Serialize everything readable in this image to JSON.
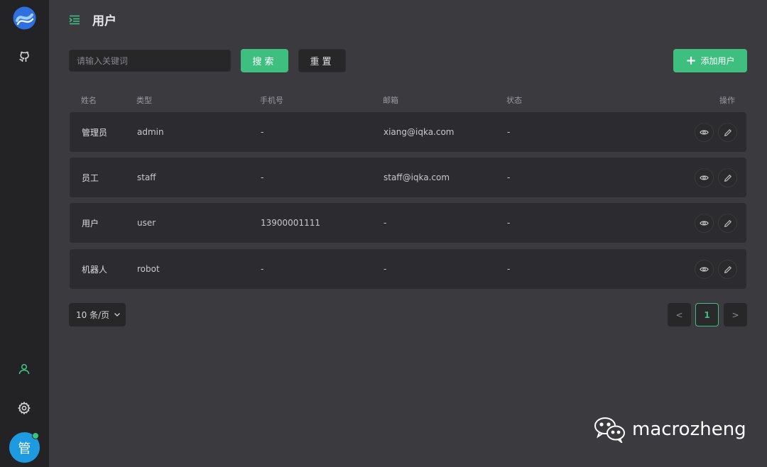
{
  "header": {
    "title": "用户"
  },
  "toolbar": {
    "search_placeholder": "请输入关键词",
    "search_label": "搜索",
    "reset_label": "重置",
    "add_label": "添加用户"
  },
  "table": {
    "columns": [
      "姓名",
      "类型",
      "手机号",
      "邮箱",
      "状态",
      "操作"
    ],
    "rows": [
      {
        "name": "管理员",
        "type": "admin",
        "phone": "-",
        "email": "xiang@iqka.com",
        "status": "-"
      },
      {
        "name": "员工",
        "type": "staff",
        "phone": "-",
        "email": "staff@iqka.com",
        "status": "-"
      },
      {
        "name": "用户",
        "type": "user",
        "phone": "13900001111",
        "email": "-",
        "status": "-"
      },
      {
        "name": "机器人",
        "type": "robot",
        "phone": "-",
        "email": "-",
        "status": "-"
      }
    ]
  },
  "pagination": {
    "page_size": "10 条/页",
    "current_page": "1",
    "prev": "<",
    "next": ">"
  },
  "sidebar": {
    "avatar_text": "管"
  },
  "watermark": {
    "text": "macrozheng"
  },
  "colors": {
    "accent": "#3fbf7f",
    "sidebar": "#232326",
    "background": "#3a3a3f",
    "row": "#2c2c30"
  }
}
